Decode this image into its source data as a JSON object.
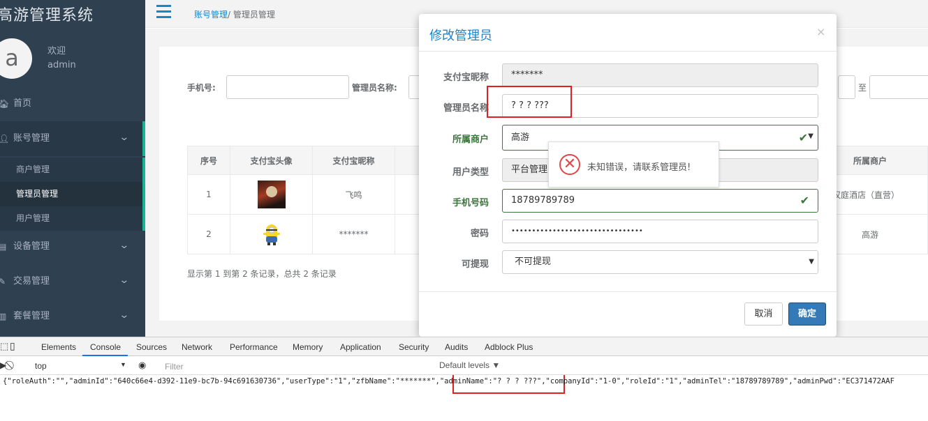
{
  "app": {
    "title": "高游管理系统",
    "avatar_letter": "a",
    "welcome": "欢迎",
    "username": "admin"
  },
  "sidebar": {
    "items": [
      {
        "icon": "home-icon",
        "label": "首页"
      },
      {
        "icon": "user-icon",
        "label": "账号管理",
        "expanded": true
      },
      {
        "icon": "device-icon",
        "label": "设备管理"
      },
      {
        "icon": "trade-icon",
        "label": "交易管理"
      },
      {
        "icon": "package-icon",
        "label": "套餐管理"
      }
    ],
    "subitems": [
      "商户管理",
      "管理员管理",
      "用户管理"
    ],
    "active_subitem": "管理员管理"
  },
  "breadcrumb": {
    "parent": "账号管理",
    "separator": "/",
    "current": "管理员管理"
  },
  "filters": {
    "phone_label": "手机号:",
    "name_label": "管理员名称:",
    "range_to": "至"
  },
  "table": {
    "headers": [
      "序号",
      "支付宝头像",
      "支付宝昵称"
    ],
    "right_header": "所属商户",
    "rows": [
      {
        "index": "1",
        "nickname": "飞鸣",
        "merchant": "汉庭酒店（直营）"
      },
      {
        "index": "2",
        "nickname": "*******",
        "merchant": "高游"
      }
    ],
    "pagination": "显示第 1 到第 2 条记录，总共 2 条记录"
  },
  "modal": {
    "title": "修改管理员",
    "close": "×",
    "fields": [
      {
        "label": "支付宝昵称",
        "value": "*******",
        "state": "disabled"
      },
      {
        "label": "管理员名称",
        "value": "? ? ? ???",
        "state": "normal"
      },
      {
        "label": "所属商户",
        "value": "高游",
        "state": "ok"
      },
      {
        "label": "用户类型",
        "value": "平台管理",
        "state": "disabled"
      },
      {
        "label": "手机号码",
        "value": "18789789789",
        "state": "ok"
      },
      {
        "label": "密码",
        "value": "••••••••••••••••••••••••••••••••",
        "state": "normal"
      },
      {
        "label": "可提现",
        "value": "不可提现",
        "state": "normal"
      }
    ],
    "cancel": "取消",
    "confirm": "确定"
  },
  "error_tooltip": {
    "text": "未知错误，请联系管理员!",
    "color": "#e24646"
  },
  "devtools": {
    "tabs": [
      "Elements",
      "Console",
      "Sources",
      "Network",
      "Performance",
      "Memory",
      "Application",
      "Security",
      "Audits",
      "Adblock Plus"
    ],
    "active_tab": "Console",
    "context": "top",
    "filter_placeholder": "Filter",
    "levels": "Default levels ▼",
    "console_output": "{\"roleAuth\":\"\",\"adminId\":\"640c66e4-d392-11e9-bc7b-94c691630736\",\"userType\":\"1\",\"zfbName\":\"*******\",\"adminName\":\"? ? ? ???\",\"companyId\":\"1-0\",\"roleId\":\"1\",\"adminTel\":\"18789789789\",\"adminPwd\":\"EC371472AAF"
  },
  "colors": {
    "sidebar": "#2f4050",
    "accent": "#1ab394",
    "link": "#1c84c6",
    "primary": "#337ab7",
    "highlight": "#e02020",
    "success": "#3c763d"
  }
}
